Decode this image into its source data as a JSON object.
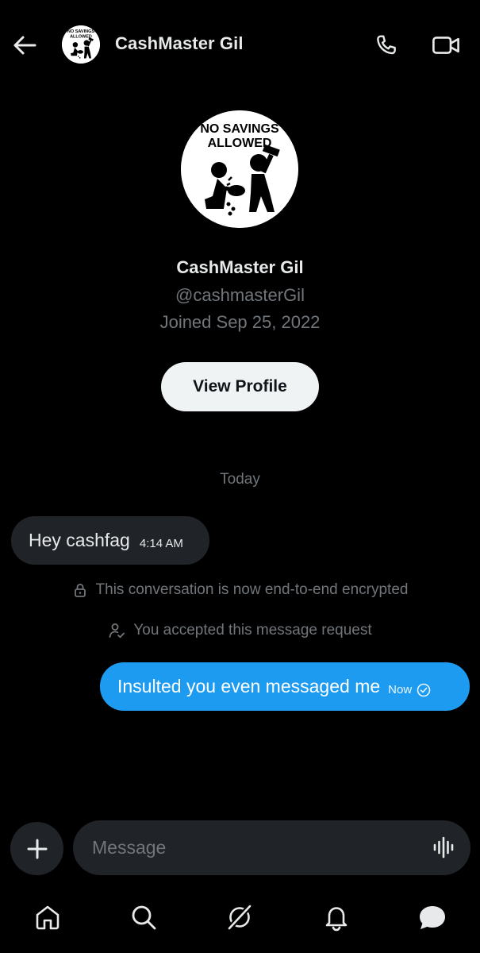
{
  "header": {
    "contact_name": "CashMaster Gil",
    "icons": [
      "back-arrow-icon",
      "phone-icon",
      "video-camera-icon"
    ]
  },
  "profile": {
    "avatar_text_line1": "NO SAVINGS",
    "avatar_text_line2": "ALLOWED",
    "name": "CashMaster Gil",
    "handle": "@cashmasterGil",
    "joined": "Joined Sep 25, 2022",
    "view_profile_label": "View Profile"
  },
  "conversation": {
    "day_label": "Today",
    "messages": [
      {
        "direction": "incoming",
        "text": "Hey cashfag",
        "time": "4:14 AM"
      },
      {
        "direction": "outgoing",
        "text": "Insulted you even messaged me",
        "time": "Now",
        "status_icon": "check-circle-icon"
      }
    ],
    "system_notices": [
      {
        "icon": "lock-icon",
        "text": "This conversation is now end-to-end encrypted"
      },
      {
        "icon": "person-check-icon",
        "text": "You accepted this message request"
      }
    ]
  },
  "composer": {
    "placeholder": "Message",
    "value": "",
    "icons": [
      "plus-icon",
      "voice-wave-icon"
    ]
  },
  "bottom_nav": {
    "items": [
      "home-icon",
      "search-icon",
      "grok-icon",
      "notifications-icon",
      "messages-icon"
    ]
  },
  "colors": {
    "background": "#000000",
    "accent": "#1d9bf0",
    "bubble_incoming": "#202327",
    "muted_text": "#71767b"
  }
}
